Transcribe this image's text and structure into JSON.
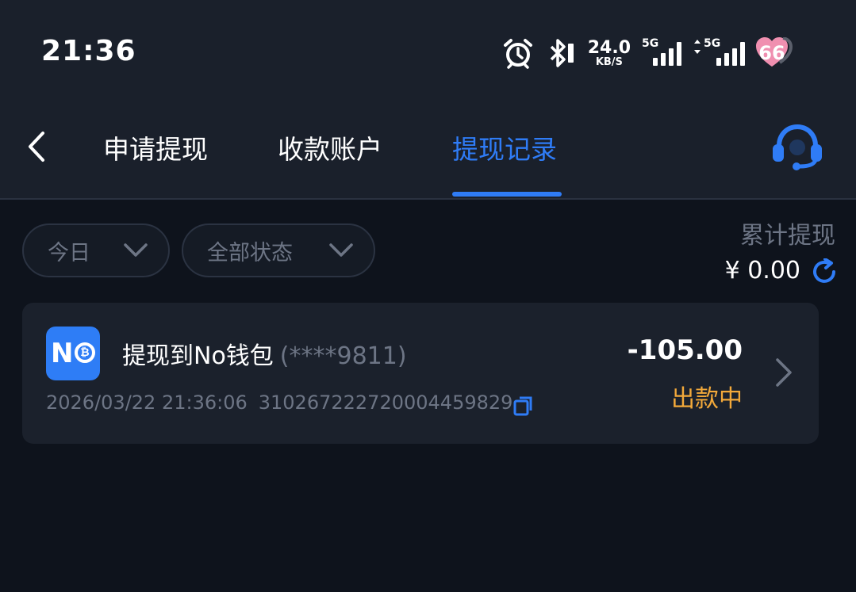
{
  "status_bar": {
    "time": "21:36",
    "net_speed_value": "24.0",
    "net_speed_unit": "KB/S",
    "signal1_label": "5G",
    "signal2_label": "5G",
    "battery_badge": "66"
  },
  "nav": {
    "tabs": [
      {
        "label": "申请提现",
        "active": false
      },
      {
        "label": "收款账户",
        "active": false
      },
      {
        "label": "提现记录",
        "active": true
      }
    ]
  },
  "filters": {
    "date": "今日",
    "status": "全部状态"
  },
  "summary": {
    "title": "累计提现",
    "amount": "¥ 0.00"
  },
  "records": [
    {
      "title": "提现到No钱包",
      "account": "(****9811)",
      "datetime": "2026/03/22 21:36:06",
      "order_id": "310267222720004459829",
      "amount": "-105.00",
      "status": "出款中"
    }
  ],
  "colors": {
    "accent": "#2f7cf6",
    "status_pending": "#f3a93a",
    "background": "#0e131c",
    "card": "#1b212c"
  },
  "icons": {
    "back": "chevron-left-icon",
    "support": "headset-icon",
    "refresh": "refresh-icon",
    "copy": "copy-icon",
    "detail": "chevron-right-icon"
  }
}
